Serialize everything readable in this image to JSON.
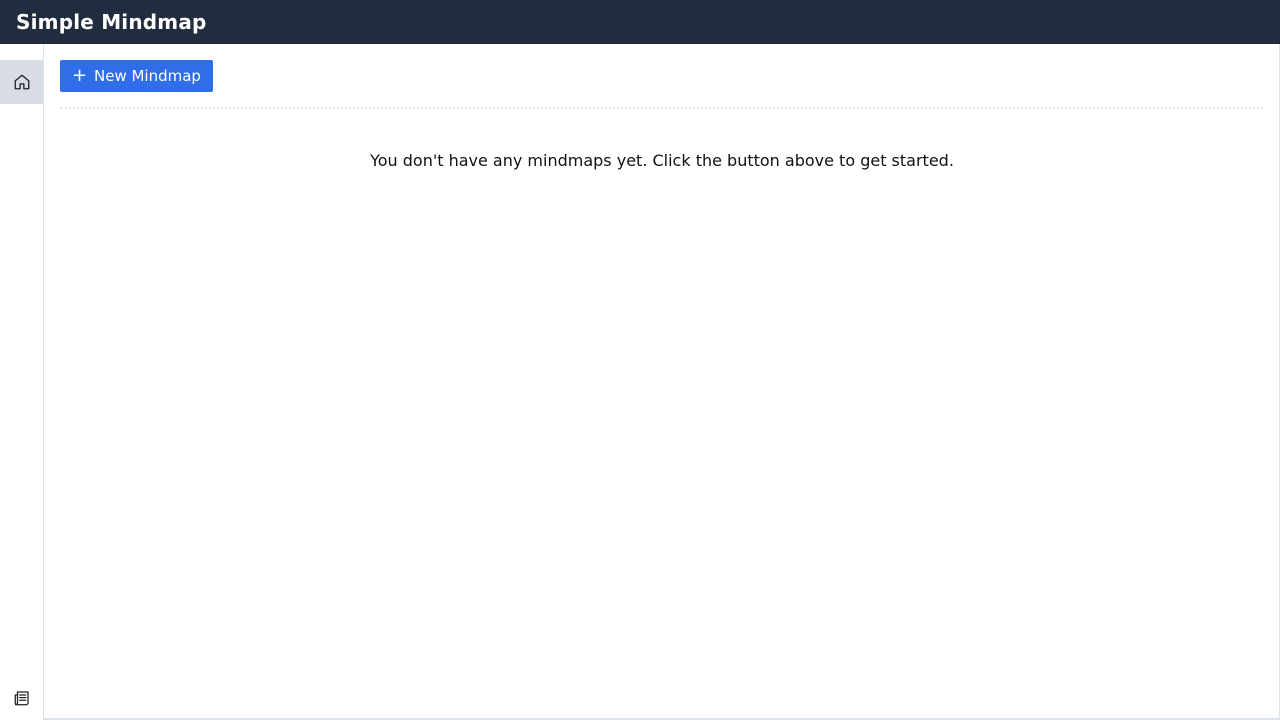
{
  "header": {
    "title": "Simple Mindmap"
  },
  "sidebar": {
    "items": [
      {
        "icon": "home-icon",
        "active": true
      },
      {
        "icon": "newspaper-icon",
        "active": false
      }
    ]
  },
  "main": {
    "new_button": {
      "icon": "plus-icon",
      "label": "New Mindmap"
    },
    "empty_message": "You don't have any mindmaps yet. Click the button above to get started."
  },
  "colors": {
    "topbar": "#212d3e",
    "primary_button": "#2f6ee8",
    "sidebar_active": "#d9dee6"
  }
}
